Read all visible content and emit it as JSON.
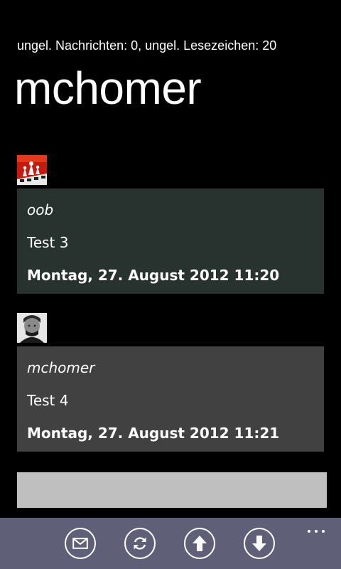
{
  "header": {
    "status_text": "ungel. Nachrichten: 0, ungel. Lesezeichen: 20",
    "title": "mchomer"
  },
  "posts": [
    {
      "author": "oob",
      "text": "Test 3",
      "date": "Montag, 27. August 2012 11:20",
      "avatar_icon": "chess-board-avatar",
      "bg_color": "#283330"
    },
    {
      "author": "mchomer",
      "text": "Test 4",
      "date": "Montag, 27. August 2012 11:21",
      "avatar_icon": "portrait-avatar",
      "bg_color": "#414141"
    }
  ],
  "input": {
    "value": ""
  },
  "appbar": {
    "buttons": [
      {
        "icon": "mail-icon"
      },
      {
        "icon": "refresh-icon"
      },
      {
        "icon": "arrow-up-icon"
      },
      {
        "icon": "arrow-down-icon"
      }
    ],
    "more_icon": "ellipsis-icon",
    "bg_color": "#5f6078"
  }
}
